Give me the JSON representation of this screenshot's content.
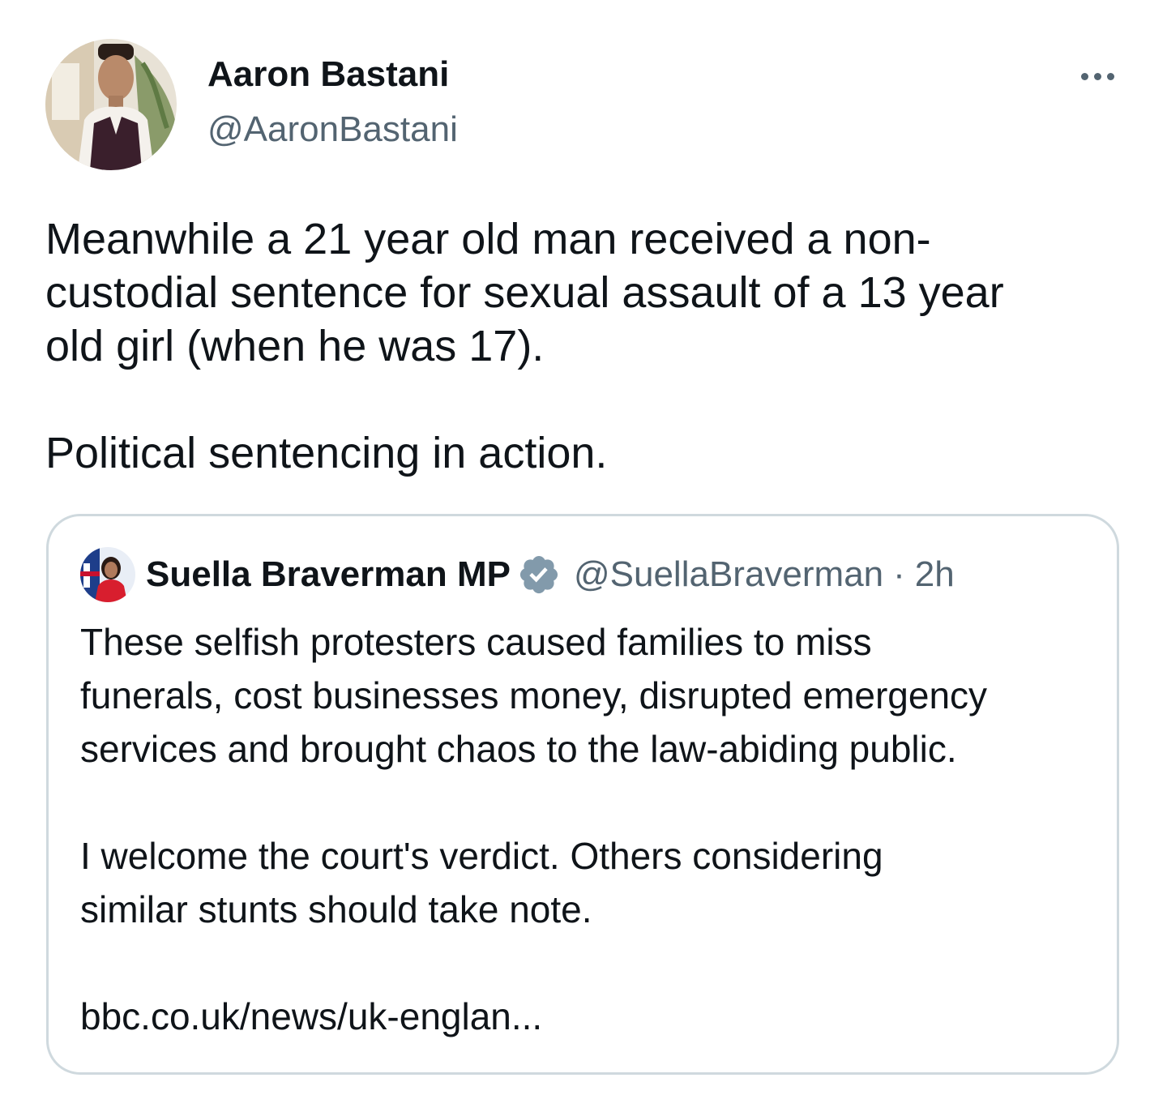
{
  "tweet": {
    "author": {
      "name": "Aaron Bastani",
      "handle": "@AaronBastani",
      "avatar_icon": "profile-photo"
    },
    "more_icon": "more-horizontal-icon",
    "text": "Meanwhile a 21 year old man received a non-\ncustodial sentence for sexual assault of a 13 year\nold girl (when he was 17).\n\nPolitical sentencing in action."
  },
  "quoted_tweet": {
    "author": {
      "name": "Suella Braverman MP",
      "handle": "@SuellaBraverman",
      "verified": true,
      "verified_icon": "verified-badge-icon",
      "avatar_icon": "profile-photo"
    },
    "separator": "·",
    "time": "2h",
    "text": "These selfish protesters caused families to miss\nfunerals, cost businesses money, disrupted emergency\nservices and brought chaos to the law-abiding public.\n\nI welcome the court's verdict. Others considering\nsimilar stunts should take note.\n\nbbc.co.uk/news/uk-englan..."
  },
  "colors": {
    "text_primary": "#0f1419",
    "text_secondary": "#536471",
    "border": "#cfd9de",
    "verified_badge": "#829aab"
  }
}
